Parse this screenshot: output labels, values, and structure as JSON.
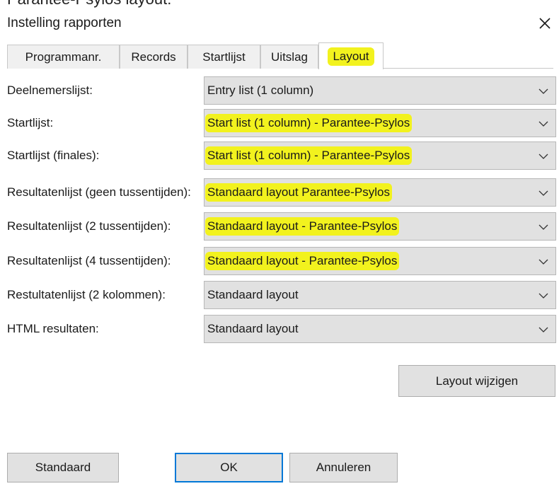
{
  "caption_cut": "Parantee-Psylos layout:",
  "dialog": {
    "title": "Instelling rapporten",
    "close_glyph": "×"
  },
  "tabs": [
    {
      "label": "Programmanr.",
      "active": false,
      "highlighted": false
    },
    {
      "label": "Records",
      "active": false,
      "highlighted": false
    },
    {
      "label": "Startlijst",
      "active": false,
      "highlighted": false
    },
    {
      "label": "Uitslag",
      "active": false,
      "highlighted": false
    },
    {
      "label": "Layout",
      "active": true,
      "highlighted": true
    }
  ],
  "settings": [
    {
      "label": "Deelnemerslijst:",
      "value": "Entry list (1 column)",
      "highlighted": false
    },
    {
      "label": "Startlijst:",
      "value": "Start list (1 column) - Parantee-Psylos",
      "highlighted": true
    },
    {
      "label": "Startlijst (finales):",
      "value": "Start list (1 column) - Parantee-Psylos",
      "highlighted": true
    },
    {
      "label": "Resultatenlijst (geen tussentijden):",
      "value": "Standaard layout Parantee-Psylos",
      "highlighted": true
    },
    {
      "label": "Resultatenlijst (2 tussentijden):",
      "value": "Standaard layout - Parantee-Psylos",
      "highlighted": true
    },
    {
      "label": "Resultatenlijst (4 tussentijden):",
      "value": "Standaard layout - Parantee-Psylos",
      "highlighted": true
    },
    {
      "label": "Restultatenlijst (2 kolommen):",
      "value": "Standaard layout",
      "highlighted": false
    },
    {
      "label": "HTML resultaten:",
      "value": "Standaard layout",
      "highlighted": false
    }
  ],
  "buttons": {
    "layout_change": "Layout wijzigen",
    "standaard": "Standaard",
    "ok": "OK",
    "cancel": "Annuleren"
  },
  "icons": {
    "close": "close-icon",
    "dropdown": "chevron-down-icon"
  },
  "colors": {
    "highlight": "#f2f21e",
    "dialog_bg": "#ffffff",
    "control_bg": "#e1e1e1",
    "default_button_border": "#0078d7"
  }
}
